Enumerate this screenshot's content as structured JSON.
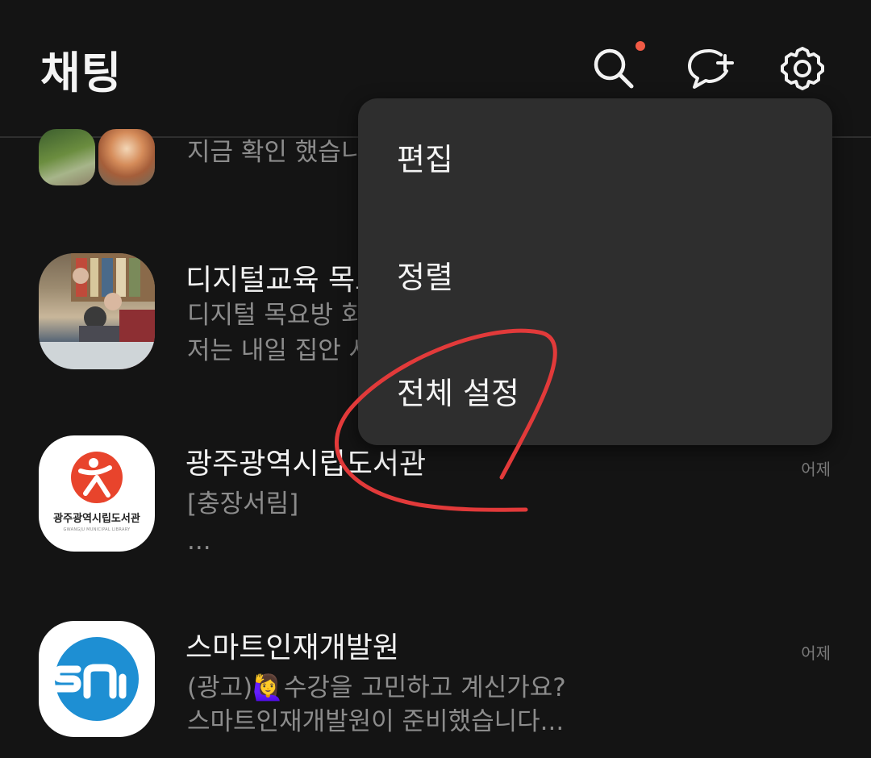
{
  "header": {
    "title": "채팅"
  },
  "icons": {
    "search": "search-icon",
    "new_chat": "new-chat-icon",
    "settings": "gear-icon"
  },
  "colors": {
    "background": "#141414",
    "menu_bg": "#2e2e2e",
    "notification_dot": "#f15a45",
    "annotation": "#e23a3a"
  },
  "chats": [
    {
      "name": "",
      "preview": [
        "지금 확인 했습니"
      ],
      "time": ""
    },
    {
      "name": "디지털교육 목요",
      "preview": [
        "디지털 목요방 회",
        "저는 내일 집안 사"
      ],
      "time": ""
    },
    {
      "name": "광주광역시립도서관",
      "preview": [
        "[충장서림]",
        "..."
      ],
      "time": "어제",
      "logo_text": "광주광역시립도서관",
      "logo_subtext": "GWANGJU MUNICIPAL LIBRARY"
    },
    {
      "name": "스마트인재개발원",
      "preview": [
        "(광고)🙋‍♀️수강을 고민하고 계신가요?",
        "스마트인재개발원이 준비했습니다..."
      ],
      "time": "어제"
    }
  ],
  "menu": {
    "items": [
      "편집",
      "정렬",
      "전체 설정"
    ]
  }
}
